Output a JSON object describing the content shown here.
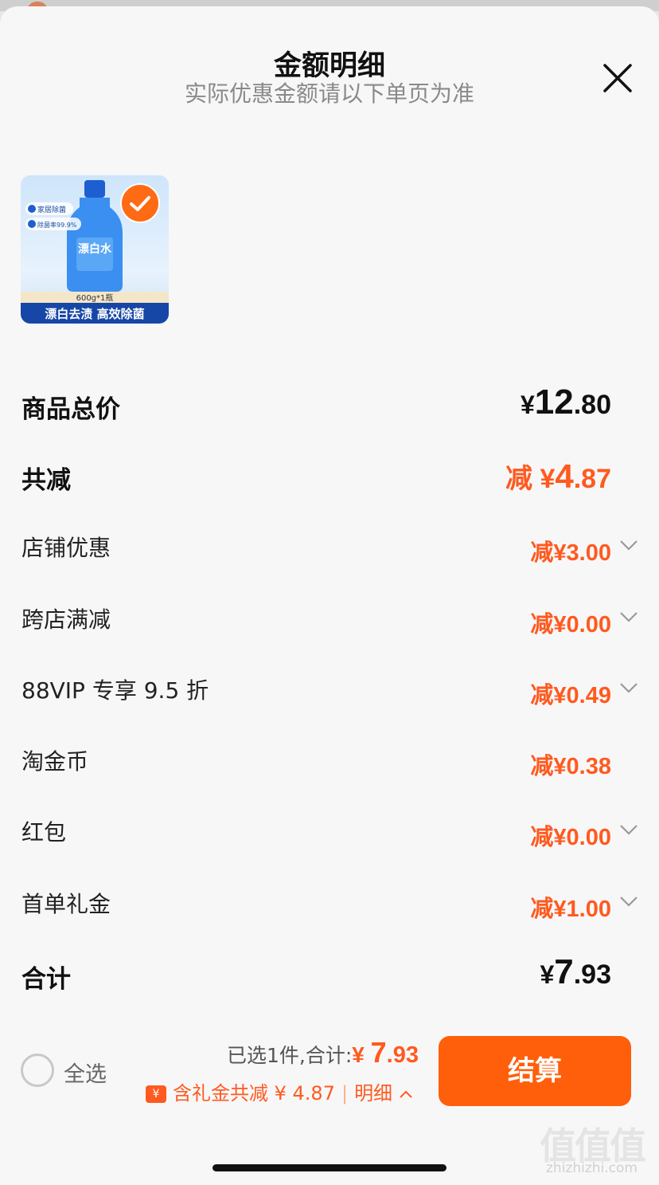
{
  "sheet": {
    "title": "金额明细",
    "subtitle": "实际优惠金额请以下单页为准",
    "close_icon": "close-icon"
  },
  "product": {
    "badge_1": "家居除菌",
    "badge_2": "除菌率99.9%",
    "product_name": "漂白水",
    "size": "600g*1瓶",
    "banner": "漂白去渍 高效除菌",
    "selected": true
  },
  "rows": {
    "total_price": {
      "label": "商品总价",
      "currency": "¥",
      "integer": "12",
      "decimal": ".80"
    },
    "total_discount": {
      "label": "共减",
      "prefix": "减 ¥",
      "integer": "4",
      "decimal": ".87"
    },
    "shop_discount": {
      "label": "店铺优惠",
      "value": "减¥3.00"
    },
    "cross_shop": {
      "label": "跨店满减",
      "value": "减¥0.00"
    },
    "vip": {
      "label": "88VIP 专享 9.5 折",
      "value": "减¥0.49"
    },
    "taojinbi": {
      "label": "淘金币",
      "value": "减¥0.38"
    },
    "red_packet": {
      "label": "红包",
      "value": "减¥0.00"
    },
    "first_order": {
      "label": "首单礼金",
      "value": "减¥1.00"
    },
    "sum": {
      "label": "合计",
      "currency": "¥",
      "integer": "7",
      "decimal": ".93"
    }
  },
  "footer": {
    "select_all": "全选",
    "selected_text": "已选1件,合计:",
    "amount_currency": "¥ ",
    "amount_integer": "7",
    "amount_decimal": ".93",
    "gift_tag": "¥",
    "gift_text": "含礼金共减 ¥ 4.87",
    "detail_link": "明细",
    "checkout_button": "结算"
  },
  "watermark": {
    "text": "值值值",
    "site": "zhizhizhi.com"
  },
  "colors": {
    "accent": "#ff5f0a",
    "discount": "#ff5a1f",
    "background": "#f7f7f8"
  }
}
